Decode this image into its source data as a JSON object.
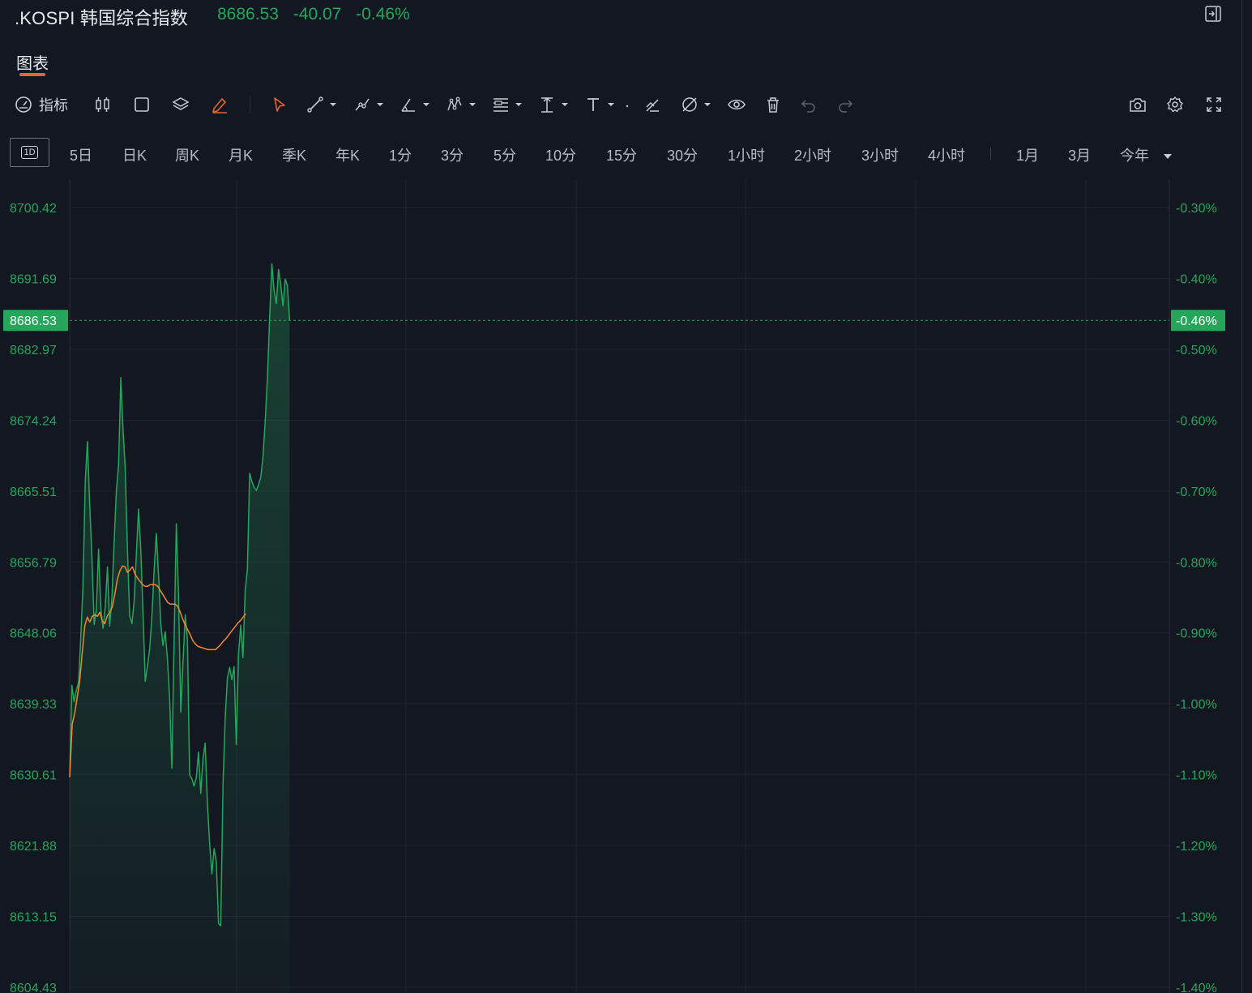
{
  "header": {
    "symbol": ".KOSPI 韩国综合指数",
    "price": "8686.53",
    "change": "-40.07",
    "change_pct": "-0.46%"
  },
  "tabs": {
    "chart": "图表"
  },
  "toolbar": {
    "indicator_label": "指标",
    "tools": [
      "candle-type",
      "rectangle",
      "layers",
      "brush",
      "cursor",
      "trend-line",
      "multi-point-line",
      "angle",
      "pattern",
      "fib-retracement",
      "measure",
      "text",
      "dot",
      "ruler-eraser",
      "magic-pen",
      "visibility",
      "trash",
      "undo",
      "redo",
      "camera",
      "settings",
      "fullscreen"
    ]
  },
  "periods": {
    "active": "1D",
    "items": [
      "5日",
      "日K",
      "周K",
      "月K",
      "季K",
      "年K",
      "1分",
      "3分",
      "5分",
      "10分",
      "15分",
      "30分",
      "1小时",
      "2小时",
      "3小时",
      "4小时"
    ],
    "range_items": [
      "1月",
      "3月",
      "今年"
    ]
  },
  "colors": {
    "background": "#131722",
    "up_green": "#26a65b",
    "avg_orange": "#f0882f",
    "accent": "#e8652a"
  },
  "chart_data": {
    "type": "line",
    "y_left_ticks": [
      "8700.42",
      "8691.69",
      "8682.97",
      "8674.24",
      "8665.51",
      "8656.79",
      "8648.06",
      "8639.33",
      "8630.61",
      "8621.88",
      "8613.15",
      "8604.43"
    ],
    "y_right_ticks": [
      "-0.30%",
      "-0.40%",
      "-0.50%",
      "-0.60%",
      "-0.70%",
      "-0.80%",
      "-0.90%",
      "-1.00%",
      "-1.10%",
      "-1.20%",
      "-1.30%",
      "-1.40%"
    ],
    "ylim": [
      8604.43,
      8700.42
    ],
    "current_price_label": "8686.53",
    "current_pct_label": "-0.46%",
    "current_price": 8686.53,
    "session_fraction_shown": 0.2,
    "series": [
      {
        "values": [
          8630.3,
          8641.6,
          8639.6,
          8641.0,
          8642.0,
          8647.6,
          8653.8,
          8666.7,
          8671.6,
          8663.8,
          8657.5,
          8649.1,
          8650.9,
          8658.4,
          8651.1,
          8648.6,
          8651.3,
          8656.2,
          8648.9,
          8652.4,
          8659.2,
          8665.5,
          8668.7,
          8679.5,
          8673.1,
          8668.4,
          8658.2,
          8650.2,
          8649.2,
          8651.9,
          8657.6,
          8663.3,
          8658.3,
          8650.5,
          8642.1,
          8643.9,
          8646.1,
          8650.0,
          8655.8,
          8660.3,
          8655.1,
          8649.2,
          8646.5,
          8648.2,
          8644.9,
          8639.8,
          8631.4,
          8646.9,
          8661.5,
          8652.6,
          8638.3,
          8644.4,
          8650.3,
          8647.1,
          8630.6,
          8630.1,
          8629.2,
          8630.3,
          8633.4,
          8628.3,
          8632.5,
          8634.5,
          8626.9,
          8622.1,
          8618.4,
          8621.5,
          8619.9,
          8612.3,
          8612.0,
          8629.3,
          8637.6,
          8642.5,
          8643.8,
          8642.3,
          8643.9,
          8634.3,
          8645.4,
          8649.0,
          8645.0,
          8653.3,
          8655.9,
          8667.7,
          8666.7,
          8666.0,
          8665.6,
          8666.3,
          8667.2,
          8669.7,
          8674.0,
          8679.4,
          8686.8,
          8693.5,
          8690.2,
          8688.6,
          8692.8,
          8691.0,
          8688.3,
          8691.6,
          8690.8,
          8686.5
        ],
        "color": "#26a65b"
      },
      {
        "values": [
          8630.3,
          8636.8,
          8638.2,
          8640.1,
          8642.2,
          8645.6,
          8648.9,
          8650.0,
          8649.4,
          8650.1,
          8650.3,
          8650.1,
          8650.6,
          8649.5,
          8649.2,
          8650.2,
          8650.6,
          8651.3,
          8652.9,
          8654.7,
          8655.7,
          8656.3,
          8656.2,
          8655.5,
          8655.8,
          8656.2,
          8655.3,
          8654.8,
          8654.4,
          8654.0,
          8653.8,
          8653.8,
          8654.0,
          8654.0,
          8654.0,
          8653.8,
          8653.3,
          8652.8,
          8652.3,
          8651.8,
          8651.6,
          8651.6,
          8651.6,
          8651.3,
          8650.6,
          8649.7,
          8649.0,
          8648.4,
          8647.8,
          8647.1,
          8646.7,
          8646.4,
          8646.3,
          8646.2,
          8646.1,
          8646.0,
          8646.0,
          8646.0,
          8646.0,
          8646.3,
          8646.6,
          8647.0,
          8647.3,
          8647.7,
          8648.1,
          8648.5,
          8648.9,
          8649.3,
          8649.6,
          8650.0,
          8650.4
        ],
        "color": "#f0882f"
      }
    ]
  }
}
